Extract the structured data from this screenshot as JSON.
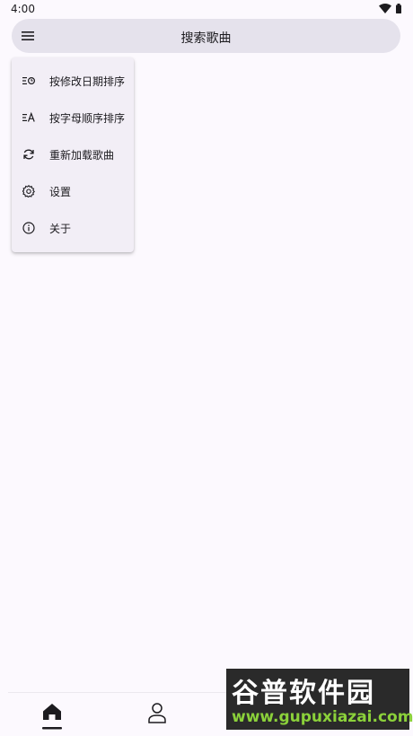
{
  "status_bar": {
    "time": "4:00"
  },
  "search": {
    "label": "搜索歌曲"
  },
  "menu": {
    "items": [
      {
        "label": "按修改日期排序",
        "icon": "sort-by-date-icon"
      },
      {
        "label": "按字母顺序排序",
        "icon": "sort-alphabetical-icon"
      },
      {
        "label": "重新加载歌曲",
        "icon": "refresh-icon"
      },
      {
        "label": "设置",
        "icon": "gear-icon"
      },
      {
        "label": "关于",
        "icon": "info-icon"
      }
    ]
  },
  "bottom_nav": {
    "items": [
      {
        "icon": "home-icon",
        "selected": true
      },
      {
        "icon": "person-icon",
        "selected": false
      }
    ]
  },
  "watermark": {
    "title": "谷普软件园",
    "url": "www.gupuxiazai.com"
  },
  "colors": {
    "background": "#fcf9fe",
    "search_bar": "#e5e2ec",
    "menu_surface": "#f2eef6",
    "text": "#1c1b1f"
  }
}
